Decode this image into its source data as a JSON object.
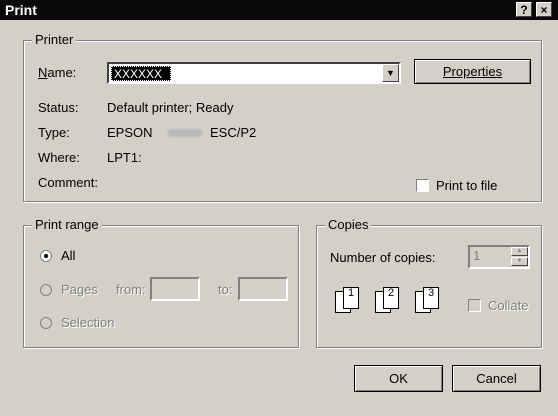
{
  "window": {
    "title": "Print",
    "help_label": "?",
    "close_label": "×"
  },
  "printer": {
    "group_label": "Printer",
    "name_label": "Name:",
    "name_value": "XXXXXX",
    "properties_label": "Properties",
    "status_label": "Status:",
    "status_value": "Default printer; Ready",
    "type_label": "Type:",
    "type_prefix": "EPSON",
    "type_suffix": "ESC/P2",
    "where_label": "Where:",
    "where_value": "LPT1:",
    "comment_label": "Comment:",
    "print_to_file_label": "Print to file"
  },
  "print_range": {
    "group_label": "Print range",
    "all_label": "All",
    "pages_label": "Pages",
    "from_label": "from:",
    "to_label": "to:",
    "selection_label": "Selection",
    "selected": "All"
  },
  "copies": {
    "group_label": "Copies",
    "number_label": "Number of copies:",
    "number_value": "1",
    "collate_label": "Collate",
    "collate_checked": false
  },
  "buttons": {
    "ok_label": "OK",
    "cancel_label": "Cancel"
  }
}
